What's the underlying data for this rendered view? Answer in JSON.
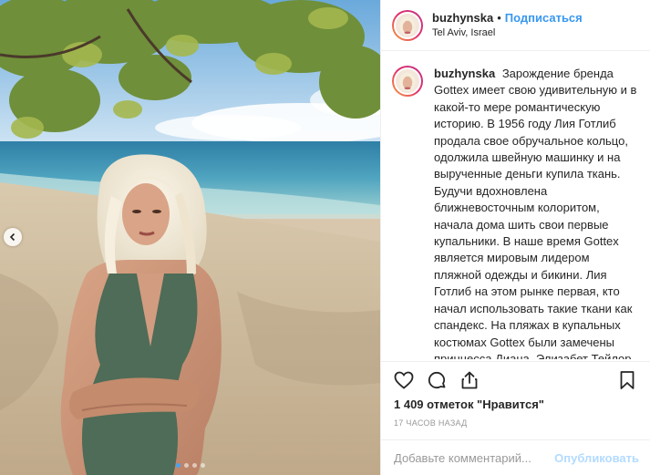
{
  "post": {
    "author": "buzhynska",
    "separator": "•",
    "follow_label": "Подписаться",
    "location": "Tel Aviv, Israel",
    "photo_alt": "",
    "carousel": {
      "dots": 4,
      "active_index": 0
    }
  },
  "caption": {
    "username": "buzhynska",
    "text": "Зарождение бренда Gottex имеет свою удивительную и в какой-то мере романтическую историю. В 1956 году Лия Готлиб продала свое обручальное кольцо, одолжила швейную машинку и на вырученные деньги купила ткань. Будучи вдохновлена ближневосточным колоритом, начала дома шить свои первые купальники. В наше время Gottex является мировым лидером пляжной одежды и бикини. Лия Готлиб на этом рынке первая, кто начал использовать такие ткани как спандекс. На пляжах в купальных костюмах Gottex были замечены принцесса Диана, Элизабет Тейлор и Брук Шилдс. (Архівні фото,з Лія Готліб ,засновницею компанії"
  },
  "actions": {
    "icons": [
      "heart-icon",
      "comment-icon",
      "share-icon",
      "bookmark-icon"
    ]
  },
  "likes_text": "1 409 отметок \"Нравится\"",
  "timestamp": "17 часов назад",
  "comment_box": {
    "placeholder": "Добавьте комментарий...",
    "publish_label": "Опубликовать"
  },
  "colors": {
    "link_blue": "#3897f0",
    "publish_disabled": "#b3dbff",
    "border": "#efefef"
  }
}
